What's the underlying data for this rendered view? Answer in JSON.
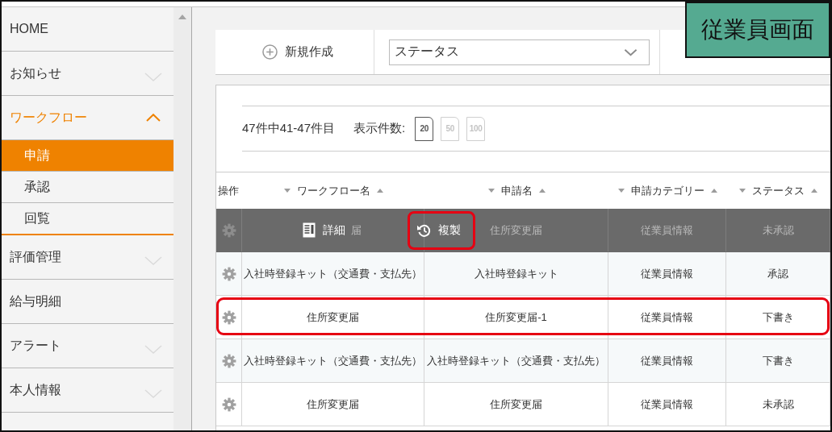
{
  "screen_label": {
    "text": "従業員画面"
  },
  "sidebar": {
    "items": [
      {
        "label": "HOME",
        "kind": "link",
        "selected": false
      },
      {
        "label": "お知らせ",
        "kind": "group",
        "selected": false,
        "expanded": false
      },
      {
        "label": "ワークフロー",
        "kind": "group",
        "selected": true,
        "expanded": true,
        "children": [
          {
            "label": "申請",
            "selected": true
          },
          {
            "label": "承認",
            "selected": false
          },
          {
            "label": "回覧",
            "selected": false
          }
        ]
      },
      {
        "label": "評価管理",
        "kind": "group",
        "selected": false,
        "expanded": false
      },
      {
        "label": "給与明細",
        "kind": "link",
        "selected": false
      },
      {
        "label": "アラート",
        "kind": "group",
        "selected": false,
        "expanded": false
      },
      {
        "label": "本人情報",
        "kind": "group",
        "selected": false,
        "expanded": false
      }
    ]
  },
  "toolbar": {
    "new_button": {
      "label": "新規作成"
    },
    "status_select": {
      "value": "ステータス"
    }
  },
  "pagination": {
    "summary": "47件中41-47件目",
    "page_size_label": "表示件数:",
    "page_sizes": [
      {
        "label": "20",
        "selected": true
      },
      {
        "label": "50",
        "selected": false
      },
      {
        "label": "100",
        "selected": false
      }
    ]
  },
  "table": {
    "columns": [
      {
        "label": "操作",
        "sortable": false
      },
      {
        "label": "ワークフロー名",
        "sortable": true
      },
      {
        "label": "申請名",
        "sortable": true
      },
      {
        "label": "申請カテゴリー",
        "sortable": true
      },
      {
        "label": "ステータス",
        "sortable": true
      }
    ],
    "rows": [
      {
        "hovered": true,
        "highlighted": false,
        "cells": [
          "",
          "届",
          "住所変更届",
          "従業員情報",
          "未承認"
        ],
        "actions": [
          {
            "label": "詳細",
            "kind": "detail",
            "highlighted": false
          },
          {
            "label": "複製",
            "kind": "copy",
            "highlighted": true
          }
        ]
      },
      {
        "hovered": false,
        "highlighted": false,
        "cells": [
          "",
          "入社時登録キット（交通費・支払先）",
          "入社時登録キット",
          "従業員情報",
          "承認"
        ]
      },
      {
        "hovered": false,
        "highlighted": true,
        "cells": [
          "",
          "住所変更届",
          "住所変更届-1",
          "従業員情報",
          "下書き"
        ]
      },
      {
        "hovered": false,
        "highlighted": false,
        "cells": [
          "",
          "入社時登録キット（交通費・支払先）",
          "入社時登録キット（交通費・支払先）",
          "従業員情報",
          "下書き"
        ]
      },
      {
        "hovered": false,
        "highlighted": false,
        "cells": [
          "",
          "住所変更届",
          "住所変更届",
          "従業員情報",
          "未承認"
        ]
      }
    ]
  }
}
